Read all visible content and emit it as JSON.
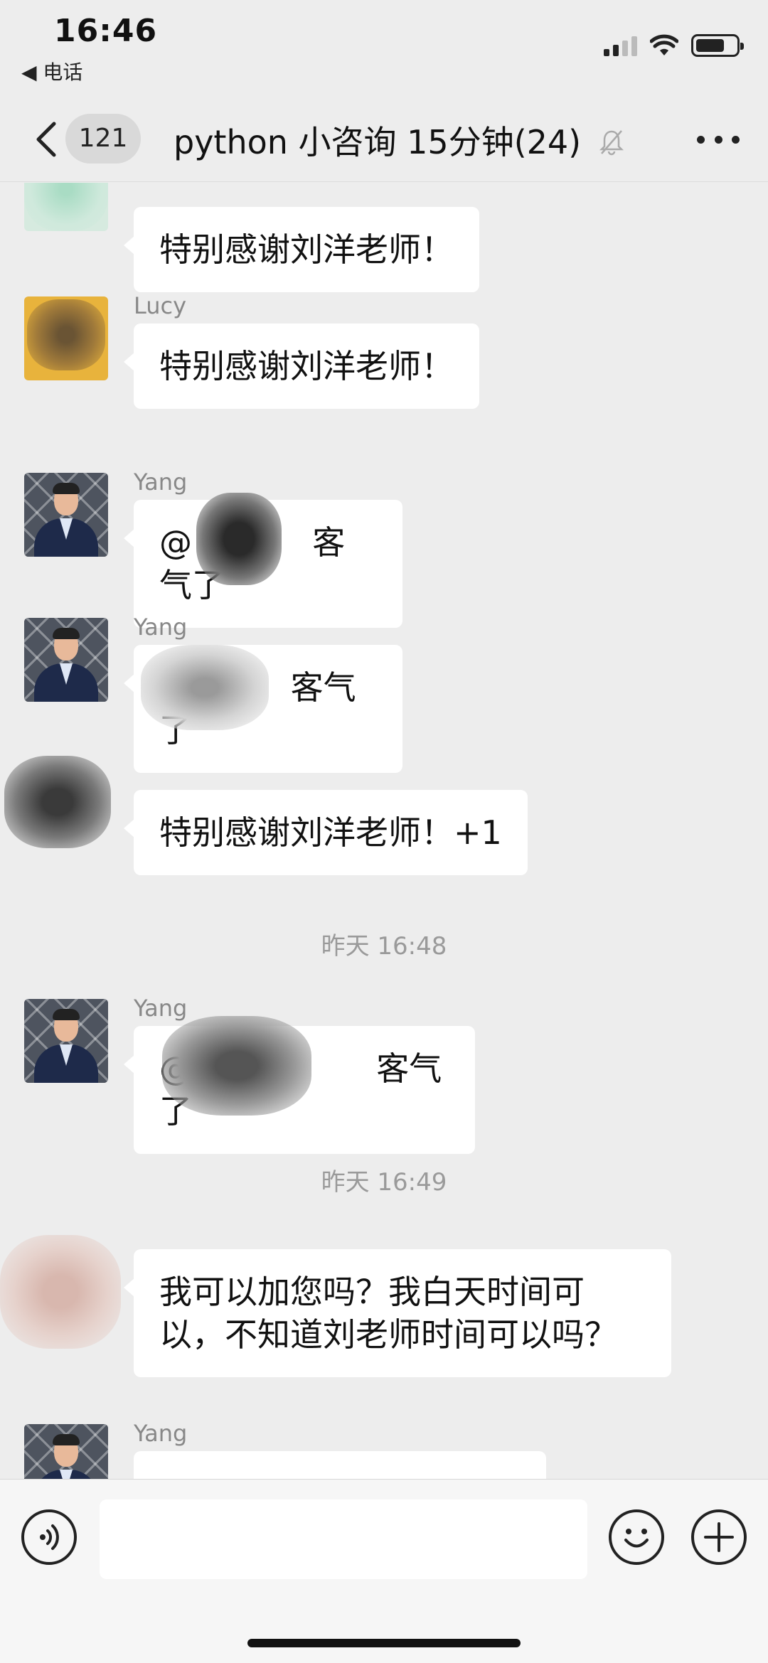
{
  "status_bar": {
    "time": "16:46",
    "back_label": "◀ 电话",
    "icons": [
      "signal-icon",
      "wifi-icon",
      "battery-icon"
    ],
    "battery_level": 0.7
  },
  "nav_bar": {
    "unread_count": "121",
    "title": "python 小咨询 15分钟(24)",
    "icons": [
      "back-chevron-icon",
      "muted-bell-icon",
      "more-icon"
    ]
  },
  "messages": [
    {
      "sender": "",
      "text": "特别感谢刘洋老师！"
    },
    {
      "sender": "Lucy",
      "text": "特别感谢刘洋老师！"
    },
    {
      "sender": "Yang",
      "text_prefix": "@",
      "text": "客气了"
    },
    {
      "sender": "Yang",
      "text": "客气了"
    },
    {
      "sender": "",
      "text": "特别感谢刘洋老师！+1"
    },
    {
      "sender": "Yang",
      "text_prefix": "@",
      "text": "客气了"
    },
    {
      "sender": "",
      "text": "我可以加您吗？我白天时间可以，不知道刘老师时间可以吗？"
    },
    {
      "sender": "Yang",
      "text": ""
    }
  ],
  "timestamps": [
    "昨天 16:48",
    "昨天 16:49"
  ],
  "input_bar": {
    "input_value": "",
    "icons": [
      "voice-icon",
      "emoji-icon",
      "plus-icon"
    ]
  },
  "colors": {
    "background": "#ededed",
    "bubble": "#ffffff",
    "timestamp": "#9a9a9a"
  }
}
